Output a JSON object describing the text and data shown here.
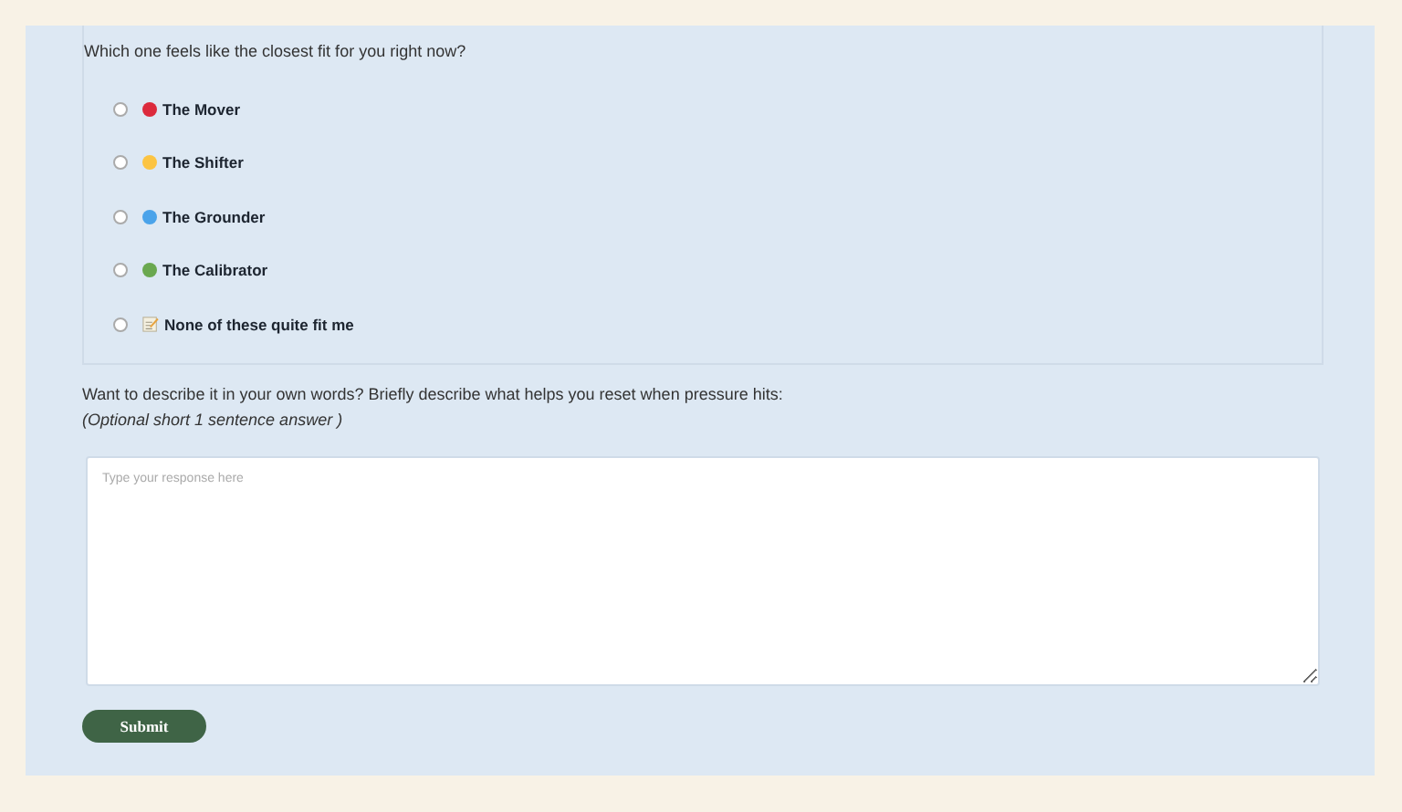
{
  "question": "Which one feels like the closest fit for you right now?",
  "options": [
    {
      "label": "The Mover",
      "kind": "dot",
      "color": "#dc2a3c",
      "selected": false
    },
    {
      "label": "The Shifter",
      "kind": "dot",
      "color": "#fcc442",
      "selected": false
    },
    {
      "label": "The Grounder",
      "kind": "dot",
      "color": "#4aa3ea",
      "selected": false
    },
    {
      "label": "The Calibrator",
      "kind": "dot",
      "color": "#6aa84f",
      "selected": false
    },
    {
      "label": "None of these quite fit me",
      "kind": "memo",
      "selected": false
    }
  ],
  "prompt": "Want to describe it in your own words? Briefly describe what helps you reset when pressure hits:",
  "hint": "(Optional short  1 sentence answer )",
  "response": {
    "placeholder": "Type your response here"
  },
  "submit": "Submit"
}
